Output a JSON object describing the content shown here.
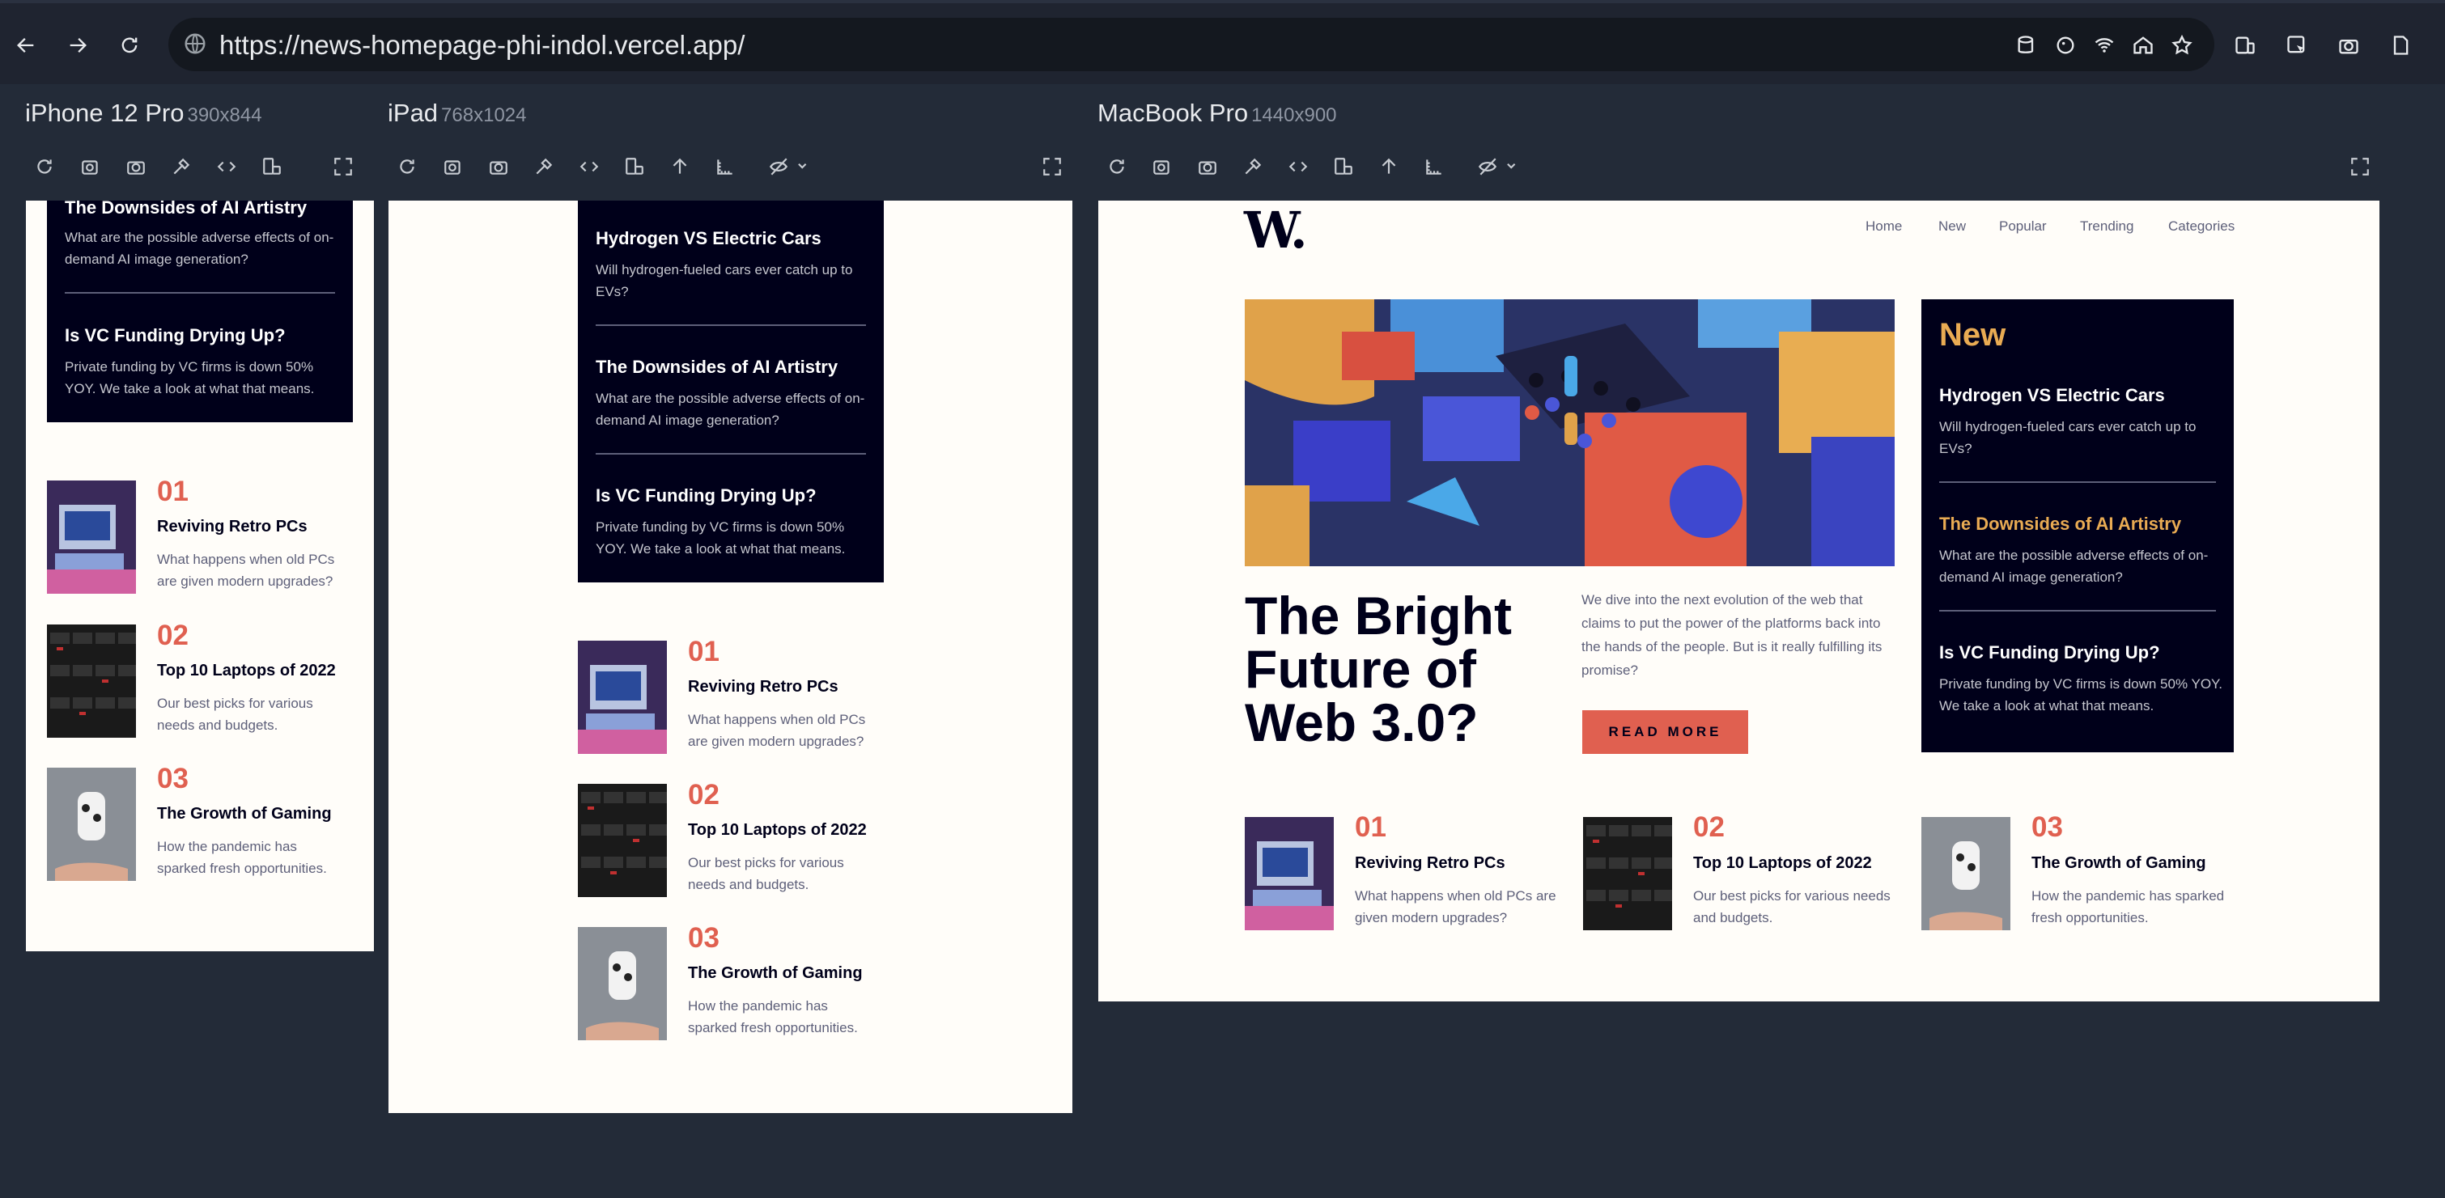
{
  "browser": {
    "url": "https://news-homepage-phi-indol.vercel.app/"
  },
  "devices": {
    "phone": {
      "name": "iPhone 12 Pro",
      "dims": "390x844"
    },
    "tablet": {
      "name": "iPad",
      "dims": "768x1024"
    },
    "desktop": {
      "name": "MacBook Pro",
      "dims": "1440x900"
    }
  },
  "site": {
    "logo": "W.",
    "nav": [
      "Home",
      "New",
      "Popular",
      "Trending",
      "Categories"
    ],
    "hero": {
      "title": "The Bright Future of Web 3.0?",
      "body": "We dive into the next evolution of the web that claims to put the power of the platforms back into the hands of the people. But is it really fulfilling its promise?",
      "cta": "READ MORE"
    },
    "new_heading": "New",
    "new_items": [
      {
        "title": "Hydrogen VS Electric Cars",
        "desc": "Will hydrogen-fueled cars ever catch up to EVs?"
      },
      {
        "title": "The Downsides of AI Artistry",
        "desc": "What are the possible adverse effects of on-demand AI image generation?"
      },
      {
        "title": "Is VC Funding Drying Up?",
        "desc": "Private funding by VC firms is down 50% YOY. We take a look at what that means."
      }
    ],
    "articles": [
      {
        "num": "01",
        "title": "Reviving Retro PCs",
        "desc": "What happens when old PCs are given modern upgrades?"
      },
      {
        "num": "02",
        "title": "Top 10 Laptops of 2022",
        "desc": "Our best picks for various needs and budgets."
      },
      {
        "num": "03",
        "title": "The Growth of Gaming",
        "desc": "How the pandemic has sparked fresh opportunities."
      }
    ]
  },
  "colors": {
    "accent": "#e06050",
    "amber": "#e9ab53",
    "dark": "#00001a",
    "muted": "#5d5f79",
    "page": "#fffdf9"
  }
}
